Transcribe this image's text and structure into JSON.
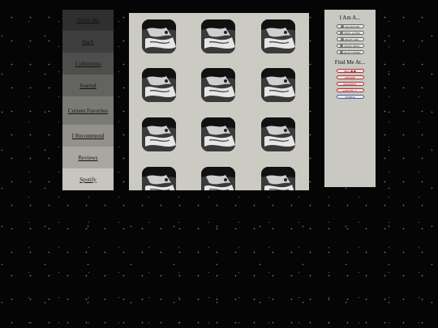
{
  "nav": {
    "items": [
      {
        "label": "About Me",
        "bg": "#2f2f2f"
      },
      {
        "label": "Back",
        "bg": "#3e3e3e"
      },
      {
        "label": "Collections",
        "bg": "#4e4e4c"
      },
      {
        "label": "Journal",
        "bg": "#63635f"
      },
      {
        "label": "Current Favorites",
        "bg": "#7a7a75"
      },
      {
        "label": "I Recommend",
        "bg": "#92918b"
      },
      {
        "label": "Reviews",
        "bg": "#a8a7a0"
      },
      {
        "label": "Spotify",
        "bg": "#c6c5bf"
      }
    ]
  },
  "gallery": {
    "tile_icon": "anime-character-avatar-icon",
    "tile_count": 12
  },
  "sidebar": {
    "i_am_heading": "I Am A...",
    "i_am_badges": [
      "COLLECTOR",
      "VINYL LOVER",
      "NIGHT OWL",
      "MUSIC NERD",
      "GOTH FRIEND"
    ],
    "find_me_heading": "Find Me At...",
    "find_me_badges": [
      {
        "label": "NEO_■ ■",
        "style": "red"
      },
      {
        "label": "MIXTAPE",
        "style": "red"
      },
      {
        "label": "PINTEREST",
        "style": "red"
      },
      {
        "label": "LAST.FM ♪♪",
        "style": "red"
      },
      {
        "label": "TUMBLR",
        "style": "blue"
      }
    ]
  }
}
